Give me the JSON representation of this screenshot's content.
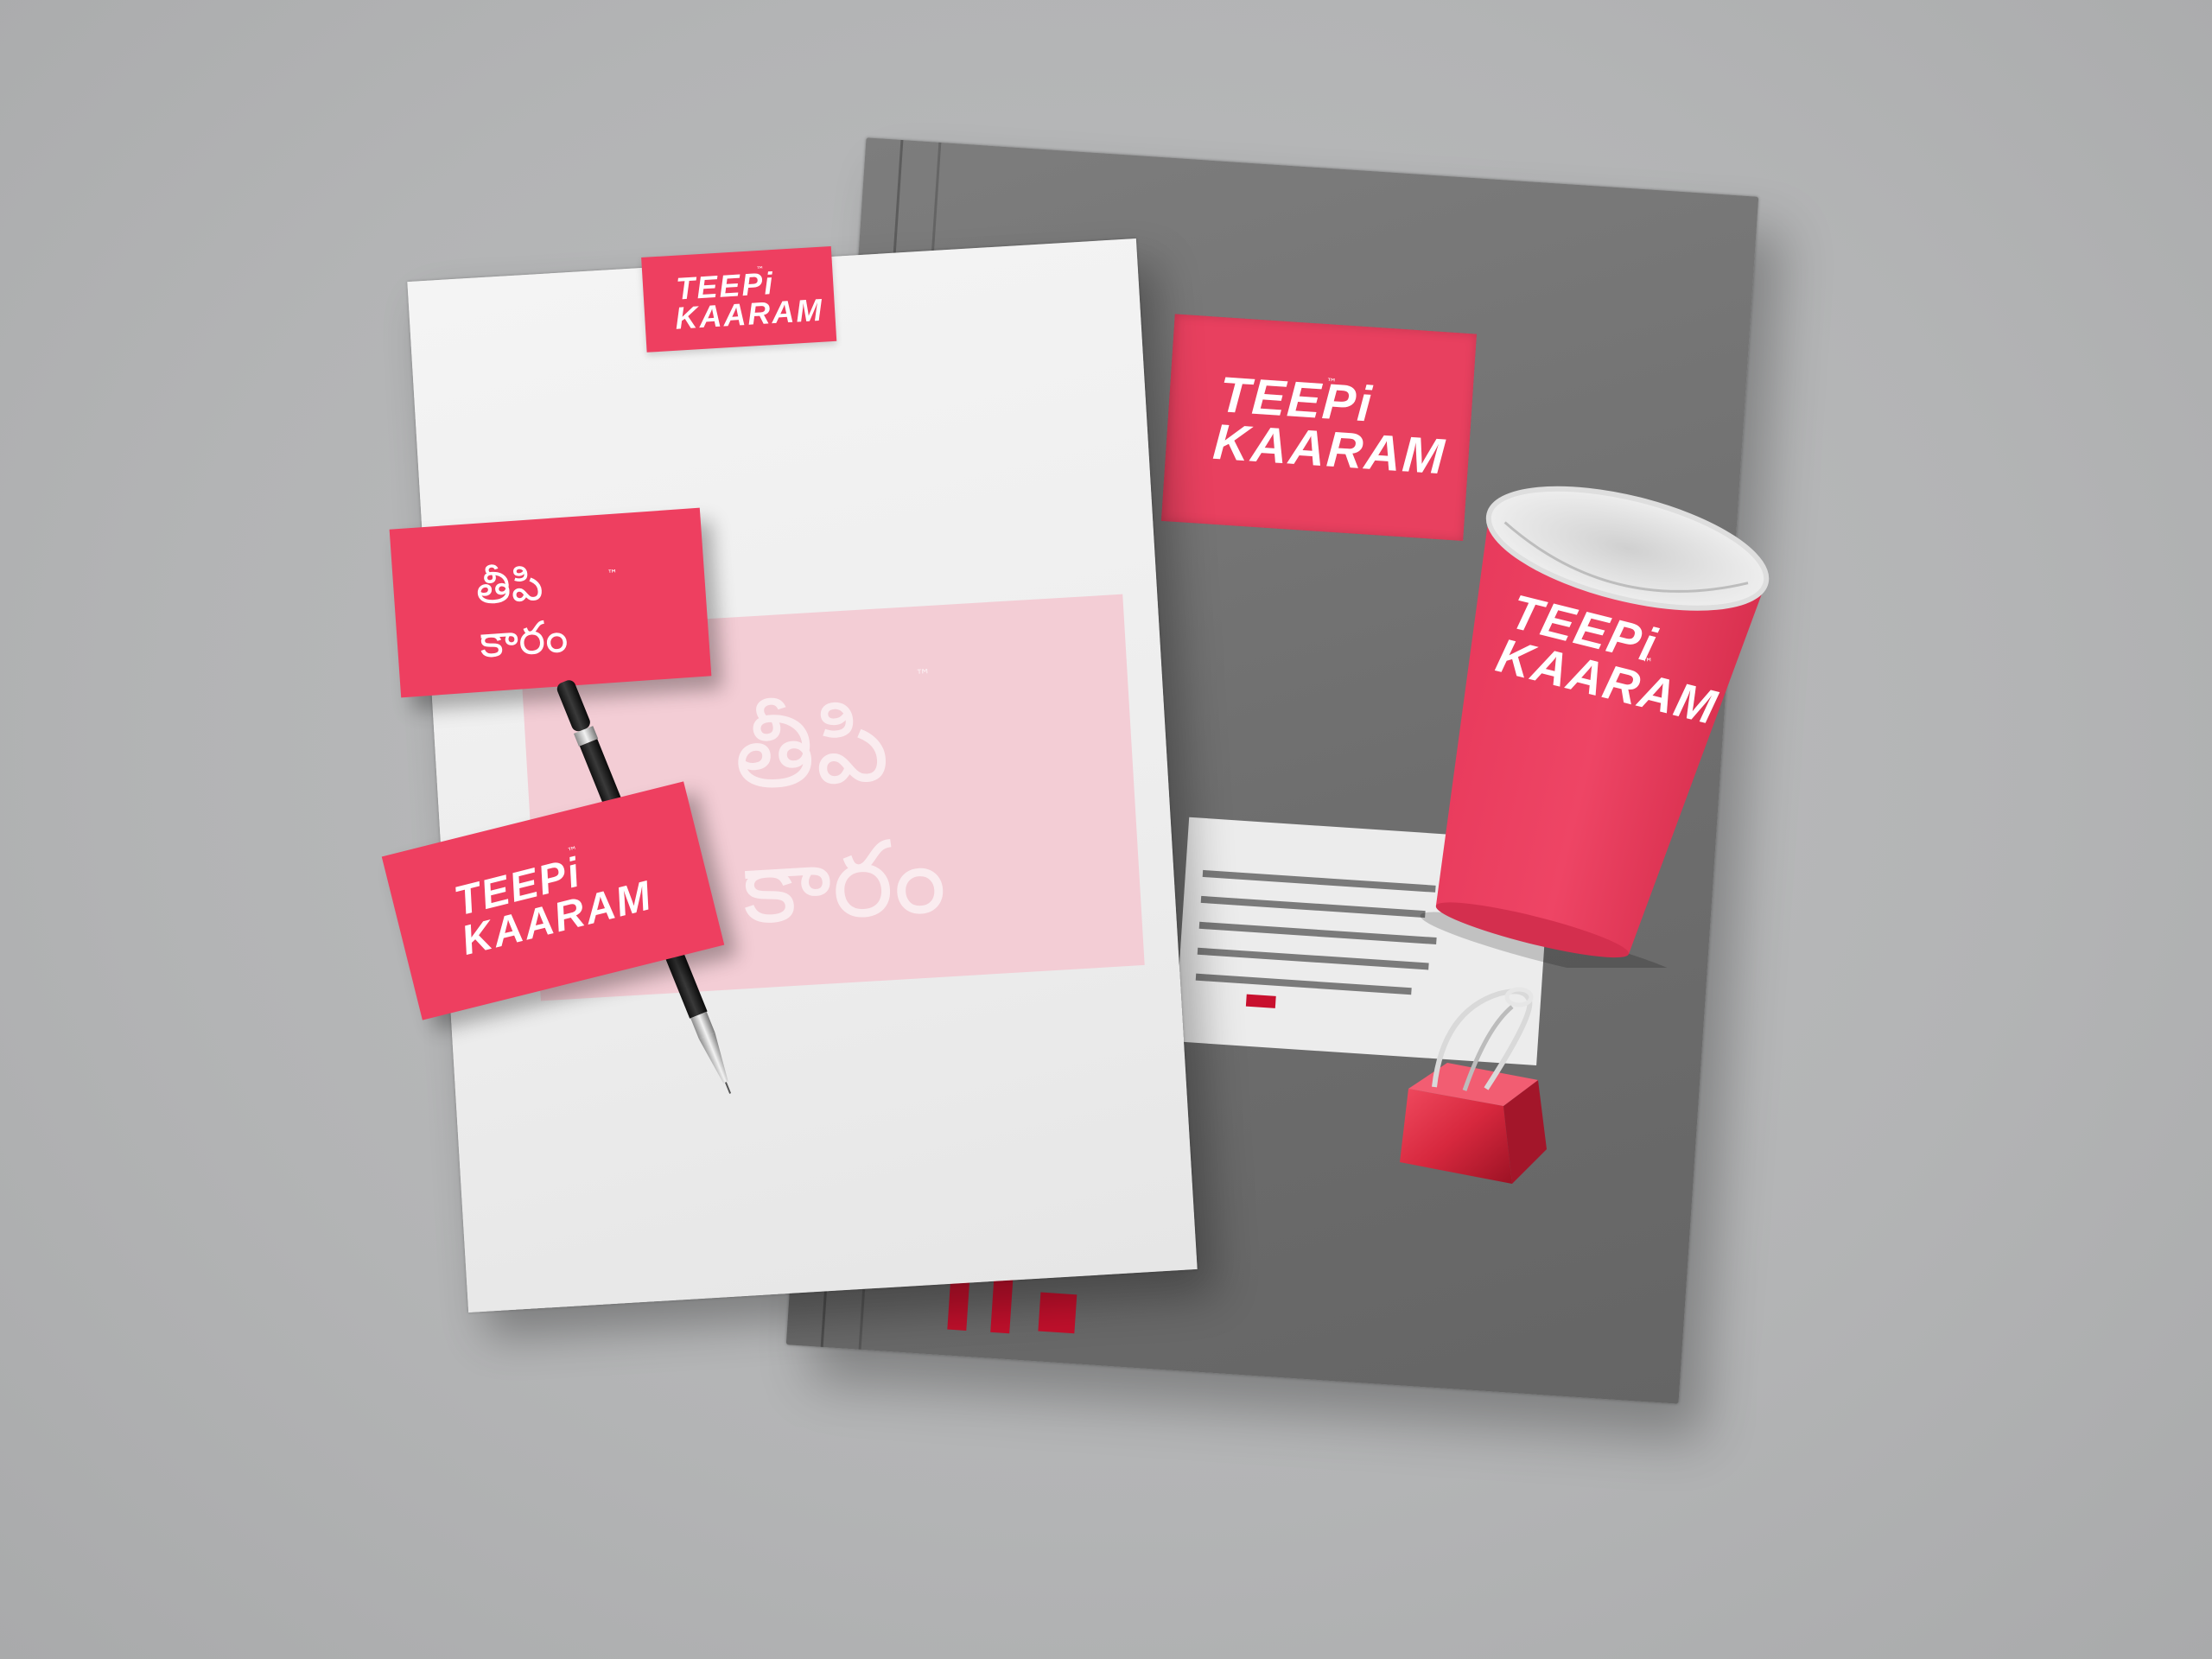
{
  "brand": {
    "line1": "TEEPi",
    "line2": "KAARAM",
    "tm": "™",
    "telugu_mark": "తీపి కారం",
    "colors": {
      "accent": "#ee3f60",
      "dark_red": "#c2102c",
      "grey": "#747474",
      "paper": "#f0f0f0"
    }
  },
  "scene": {
    "items": [
      "notebook",
      "letterhead",
      "business-card-telugu",
      "business-card-english",
      "pen",
      "paper-cup",
      "binder-clip"
    ]
  }
}
